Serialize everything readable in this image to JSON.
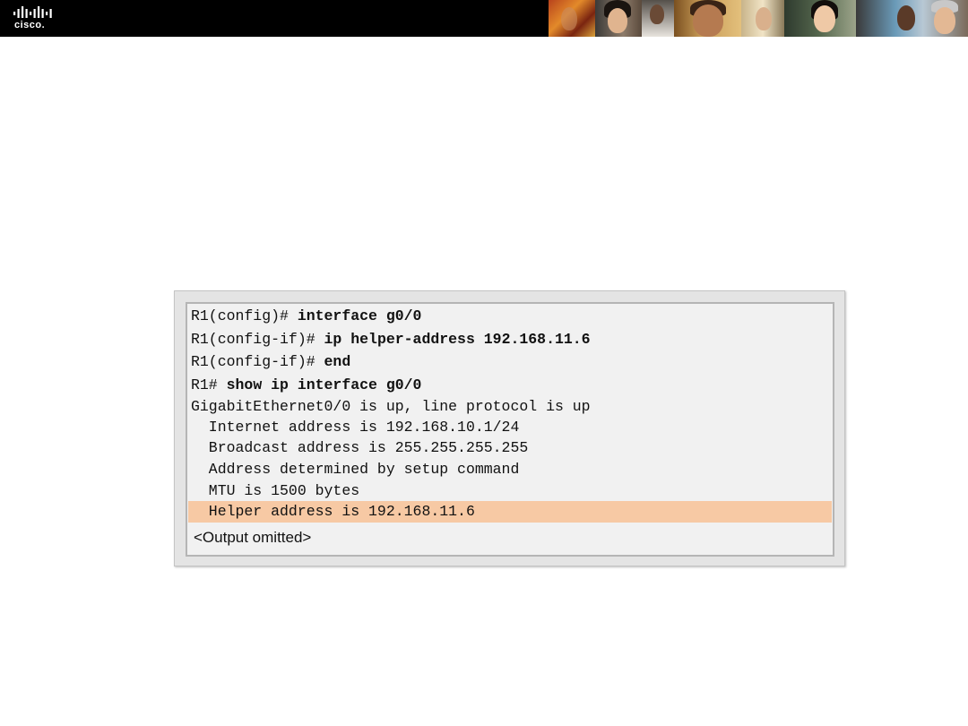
{
  "header": {
    "logo_text": "cisco.",
    "colors": {
      "bar": "#000000",
      "logo": "#ffffff"
    },
    "photos": [
      "photo-1",
      "photo-2",
      "photo-3",
      "photo-4",
      "photo-5",
      "photo-6",
      "photo-7"
    ]
  },
  "terminal": {
    "lines": [
      {
        "prompt": "R1(config)# ",
        "command": "interface g0/0"
      },
      {
        "prompt": "R1(config-if)# ",
        "command": "ip helper-address 192.168.11.6"
      },
      {
        "prompt": "R1(config-if)# ",
        "command": "end"
      },
      {
        "prompt": "R1# ",
        "command": "show ip interface g0/0"
      }
    ],
    "output": [
      "GigabitEthernet0/0 is up, line protocol is up",
      "  Internet address is 192.168.10.1/24",
      "  Broadcast address is 255.255.255.255",
      "  Address determined by setup command",
      "  MTU is 1500 bytes",
      "  Helper address is 192.168.11.6"
    ],
    "omitted": "<Output omitted>",
    "highlight_color": "#f7c9a4"
  }
}
